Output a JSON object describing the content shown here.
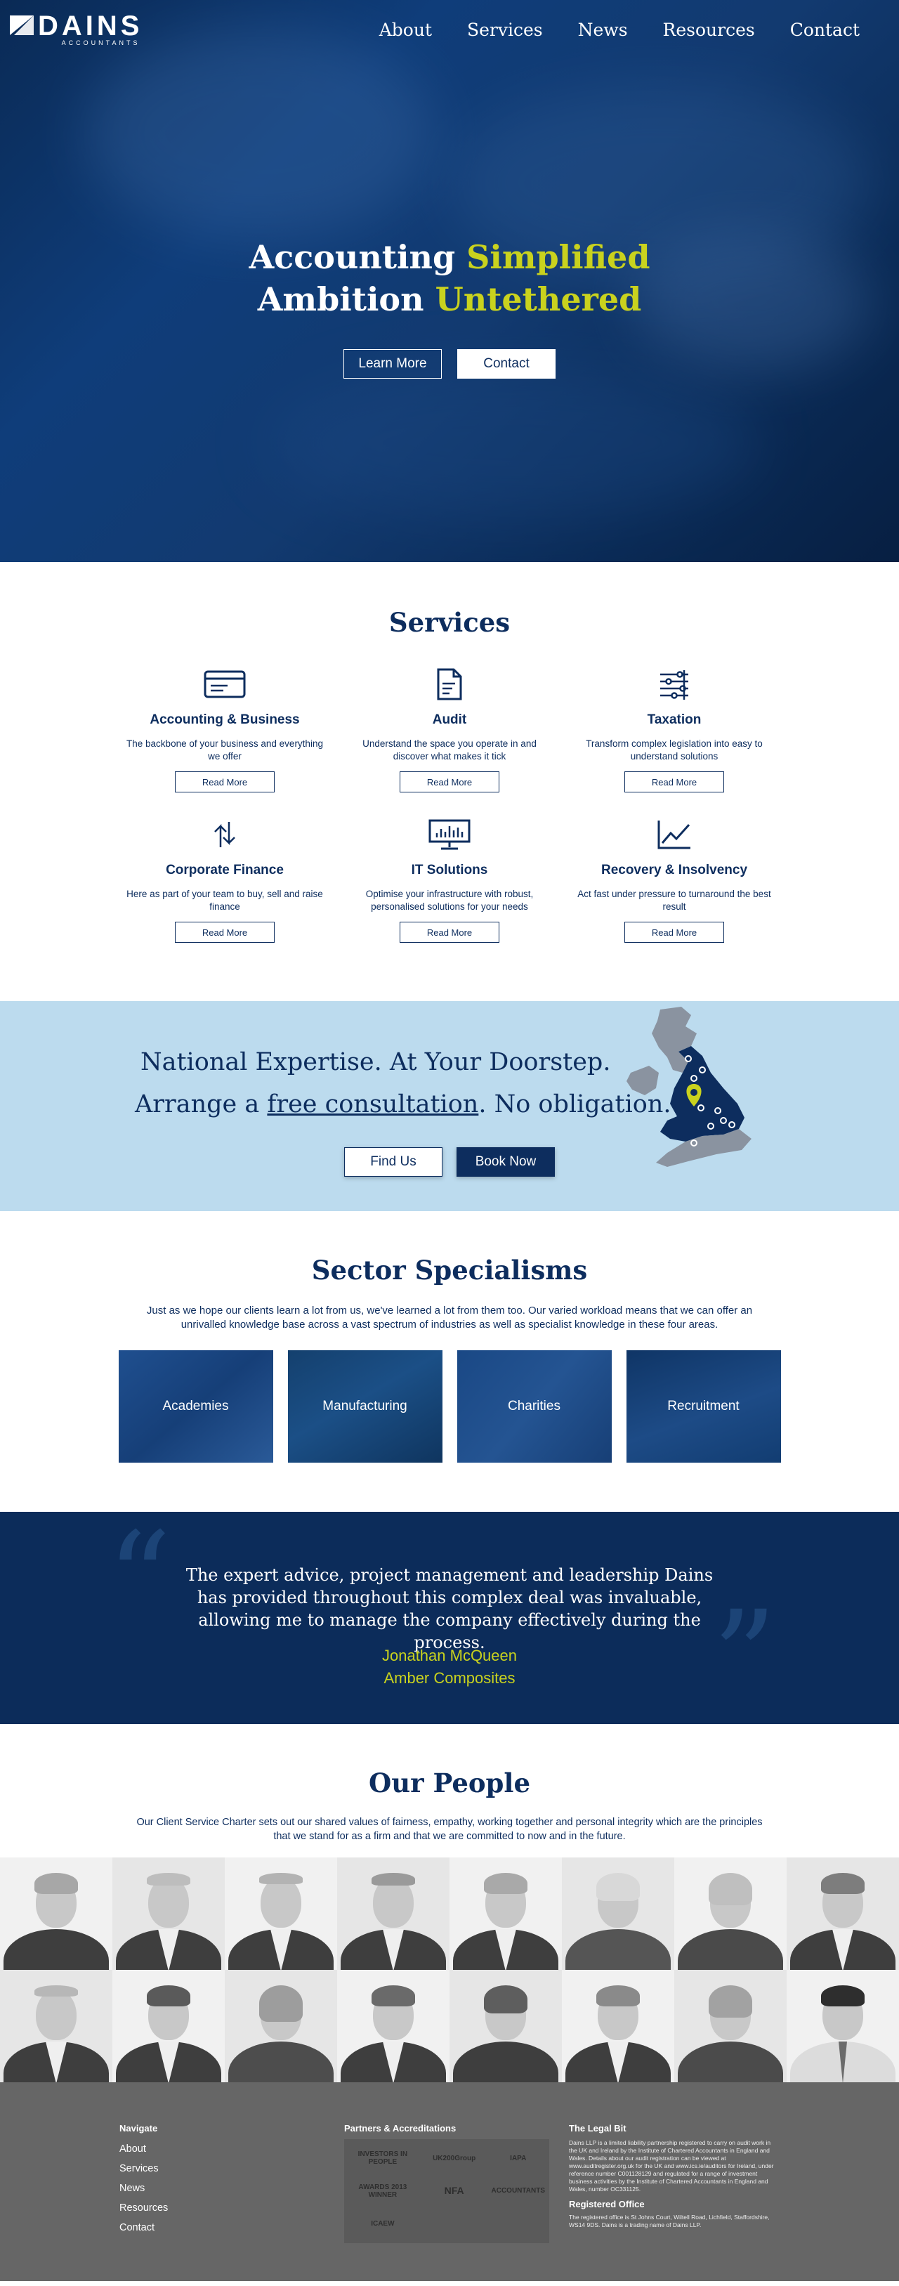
{
  "header": {
    "logo_text": "DAINS",
    "logo_sub": "ACCOUNTANTS",
    "nav": [
      "About",
      "Services",
      "News",
      "Resources",
      "Contact"
    ]
  },
  "hero": {
    "line1_plain": "Accounting",
    "line1_accent": "Simplified",
    "line2_plain": "Ambition",
    "line2_accent": "Untethered",
    "learn_more": "Learn More",
    "contact": "Contact",
    "accent_color": "#c9d21e"
  },
  "services": {
    "title": "Services",
    "items": [
      {
        "icon": "card-icon",
        "title": "Accounting & Business",
        "desc": "The backbone of your business and everything we offer",
        "button": "Read More"
      },
      {
        "icon": "document-icon",
        "title": "Audit",
        "desc": "Understand the space you operate in and discover what makes it tick",
        "button": "Read More"
      },
      {
        "icon": "sliders-icon",
        "title": "Taxation",
        "desc": "Transform complex legislation into easy to understand solutions",
        "button": "Read More"
      },
      {
        "icon": "arrows-icon",
        "title": "Corporate Finance",
        "desc": "Here as part of your team to buy, sell and raise finance",
        "button": "Read More"
      },
      {
        "icon": "monitor-icon",
        "title": "IT Solutions",
        "desc": "Optimise your infrastructure with robust, personalised solutions for your needs",
        "button": "Read More"
      },
      {
        "icon": "line-chart-icon",
        "title": "Recovery & Insolvency",
        "desc": "Act fast under pressure to turnaround the best result",
        "button": "Read More"
      }
    ]
  },
  "cta": {
    "line1": "National Expertise. At Your Doorstep.",
    "line2_before": "Arrange a ",
    "line2_link": "free consultation",
    "line2_after": ". No obligation.",
    "find_us": "Find Us",
    "book_now": "Book Now"
  },
  "sectors": {
    "title": "Sector Specialisms",
    "intro": "Just as we hope our clients learn a lot from us, we've learned a lot from them too. Our varied workload means that we can offer an unrivalled knowledge base across a vast spectrum of industries as well as specialist knowledge in these four areas.",
    "items": [
      "Academies",
      "Manufacturing",
      "Charities",
      "Recruitment"
    ]
  },
  "testimonial": {
    "quote": "The expert advice, project management and leadership Dains has provided throughout this complex deal was invaluable, allowing me to manage the company effectively during the process.",
    "author": "Jonathan McQueen",
    "company": "Amber Composites"
  },
  "people": {
    "title": "Our People",
    "intro": "Our Client Service Charter sets out our shared values of fairness, empathy, working together and personal integrity which are the principles that we stand for as a firm and that we are committed to now and in the future."
  },
  "footer": {
    "navigate_title": "Navigate",
    "navigate_links": [
      "About",
      "Services",
      "News",
      "Resources",
      "Contact"
    ],
    "partners_title": "Partners & Accreditations",
    "partner_logos": [
      "INVESTORS IN PEOPLE",
      "UK200Group",
      "IAPA",
      "AWARDS 2013 WINNER",
      "NFA",
      "ACCOUNTANTS",
      "ICAEW"
    ],
    "legal_title": "The Legal Bit",
    "legal_text": "Dains LLP is a limited liability partnership registered to carry on audit work in the UK and Ireland by the Institute of Chartered Accountants in England and Wales. Details about our audit registration can be viewed at www.auditregister.org.uk for the UK and www.ics.ie/auditors for Ireland, under reference number C001128129 and regulated for a range of investment business activities by the Institute of Chartered Accountants in England and Wales, number OC331125.",
    "office_title": "Registered Office",
    "office_text": "The registered office is St Johns Court, Wiltell Road, Lichfield, Staffordshire, WS14 9DS. Dains is a trading name of Dains LLP."
  }
}
